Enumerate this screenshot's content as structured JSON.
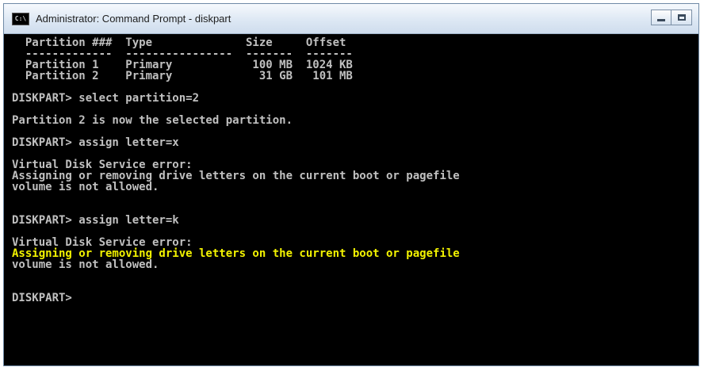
{
  "window": {
    "title": "Administrator: Command Prompt - diskpart",
    "icon_name": "cmd-icon",
    "icon_text": "C:\\",
    "minimize_icon": "minimize-icon",
    "maximize_icon": "maximize-icon"
  },
  "console": {
    "lines": [
      {
        "text": "  Partition ###  Type              Size     Offset",
        "color": "gray"
      },
      {
        "text": "  -------------  ----------------  -------  -------",
        "color": "gray"
      },
      {
        "text": "  Partition 1    Primary            100 MB  1024 KB",
        "color": "gray"
      },
      {
        "text": "  Partition 2    Primary             31 GB   101 MB",
        "color": "gray"
      },
      {
        "text": "",
        "color": "gray"
      },
      {
        "text": "DISKPART> select partition=2",
        "color": "gray"
      },
      {
        "text": "",
        "color": "gray"
      },
      {
        "text": "Partition 2 is now the selected partition.",
        "color": "gray"
      },
      {
        "text": "",
        "color": "gray"
      },
      {
        "text": "DISKPART> assign letter=x",
        "color": "gray"
      },
      {
        "text": "",
        "color": "gray"
      },
      {
        "text": "Virtual Disk Service error:",
        "color": "gray"
      },
      {
        "text": "Assigning or removing drive letters on the current boot or pagefile",
        "color": "gray"
      },
      {
        "text": "volume is not allowed.",
        "color": "gray"
      },
      {
        "text": "",
        "color": "gray"
      },
      {
        "text": "",
        "color": "gray"
      },
      {
        "text": "DISKPART> assign letter=k",
        "color": "gray"
      },
      {
        "text": "",
        "color": "gray"
      },
      {
        "text": "Virtual Disk Service error:",
        "color": "gray"
      },
      {
        "text": "Assigning or removing drive letters on the current boot or pagefile",
        "color": "yellow"
      },
      {
        "text": "volume is not allowed.",
        "color": "gray"
      },
      {
        "text": "",
        "color": "gray"
      },
      {
        "text": "",
        "color": "gray"
      },
      {
        "text": "DISKPART>",
        "color": "gray"
      }
    ]
  },
  "colors": {
    "console_bg": "#000000",
    "console_text": "#c0c0c0",
    "highlight_text": "#f2f200",
    "titlebar": "#dde8f4"
  }
}
